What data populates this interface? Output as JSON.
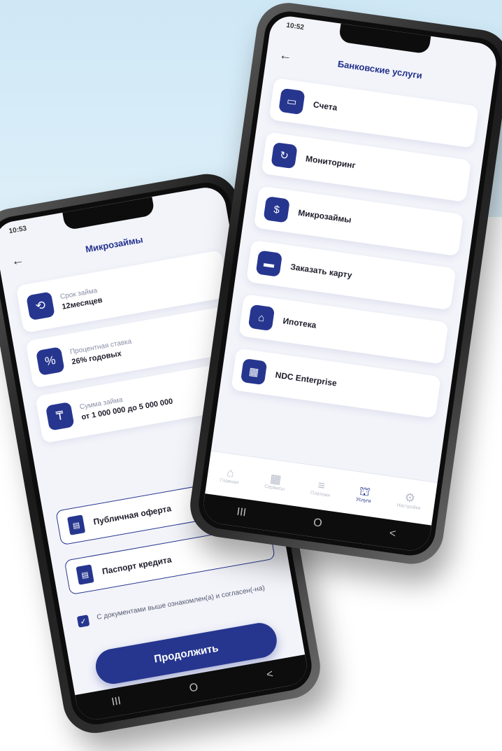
{
  "left_phone": {
    "status_time": "10:53",
    "title": "Микрозаймы",
    "back_icon": "arrow-left-icon",
    "cards": [
      {
        "label": "Срок займа",
        "value": "12месяцев",
        "icon": "history-icon"
      },
      {
        "label": "Процентная ставка",
        "value": "26% годовых",
        "icon": "percent-cycle-icon"
      },
      {
        "label": "Сумма займа",
        "value": "от 1 000 000 до 5 000 000",
        "icon": "money-icon"
      }
    ],
    "documents": [
      {
        "label": "Публичная оферта",
        "icon": "document-icon"
      },
      {
        "label": "Паспорт кредита",
        "icon": "document-icon"
      }
    ],
    "agreement_text": "С документами выше ознакомлен(а) и согласен(-на)",
    "agreement_checked": true,
    "continue_label": "Продолжить",
    "nav": [
      "III",
      "O",
      "<"
    ]
  },
  "right_phone": {
    "status_time": "10:52",
    "title": "Банковские услуги",
    "back_icon": "arrow-left-icon",
    "menu": [
      {
        "label": "Счета",
        "icon": "accounts-icon"
      },
      {
        "label": "Мониторинг",
        "icon": "monitoring-icon"
      },
      {
        "label": "Микрозаймы",
        "icon": "coin-icon"
      },
      {
        "label": "Заказать карту",
        "icon": "card-icon"
      },
      {
        "label": "Ипотека",
        "icon": "house-icon"
      },
      {
        "label": "NDC Enterprise",
        "icon": "enterprise-icon"
      }
    ],
    "tabs": [
      {
        "label": "Главная",
        "icon": "home-icon"
      },
      {
        "label": "Сервисы",
        "icon": "grid-icon"
      },
      {
        "label": "Платежи",
        "icon": "payments-icon"
      },
      {
        "label": "Услуги",
        "icon": "bank-icon",
        "active": true
      },
      {
        "label": "Настройки",
        "icon": "settings-icon"
      }
    ],
    "nav": [
      "III",
      "O",
      "<"
    ]
  },
  "colors": {
    "accent": "#26368f",
    "background_top": "#cfe8f6",
    "screen_bg": "#f3f4fa"
  }
}
